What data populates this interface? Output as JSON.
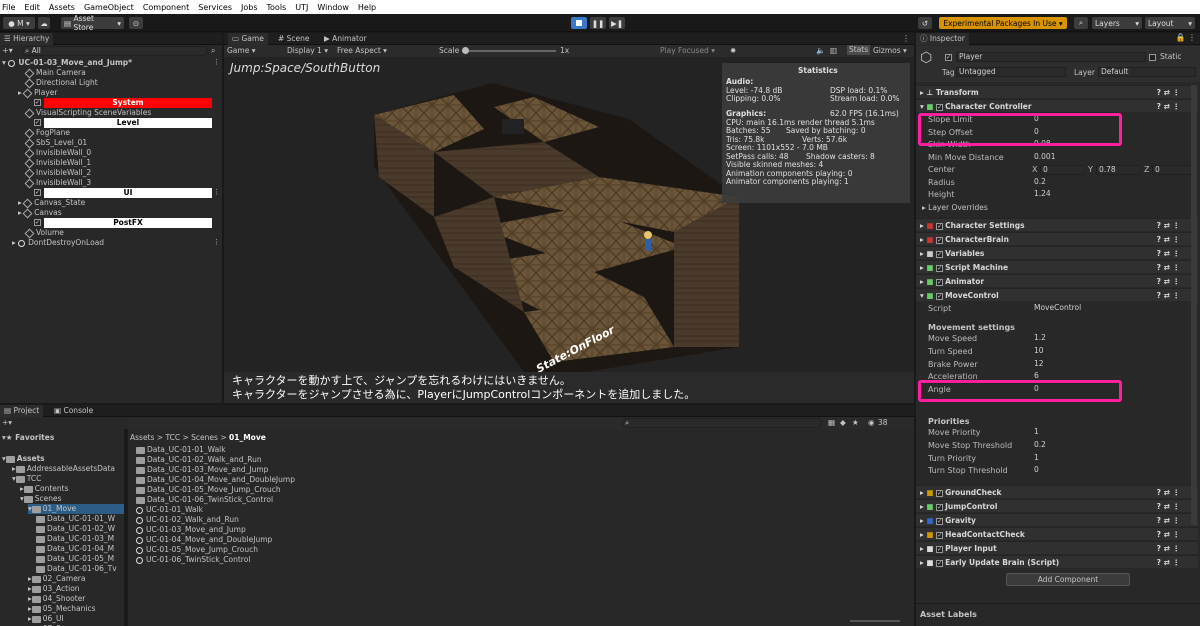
{
  "menu": [
    "File",
    "Edit",
    "Assets",
    "GameObject",
    "Component",
    "Services",
    "Jobs",
    "Tools",
    "UTJ",
    "Window",
    "Help"
  ],
  "toolbar": {
    "account": "M",
    "asset_store": "Asset Store",
    "experimental": "Experimental Packages In Use",
    "layers": "Layers",
    "layout": "Layout"
  },
  "hierarchy": {
    "tab": "Hierarchy",
    "search": "All",
    "scene": "UC-01-03_Move_and_Jump*",
    "items": [
      "Main Camera",
      "Directional Light",
      "Player",
      "System",
      "VisualScripting SceneVariables",
      "Level",
      "FogPlane",
      "SbS_Level_01",
      "InvisibleWall_0",
      "InvisibleWall_1",
      "InvisibleWall_2",
      "InvisibleWall_3",
      "UI",
      "Canvas_State",
      "Canvas",
      "PostFX",
      "Volume",
      "DontDestroyOnLoad"
    ]
  },
  "scene": {
    "tabs": [
      "Game",
      "Scene",
      "Animator"
    ],
    "display": "Game",
    "display_num": "Display 1",
    "aspect": "Free Aspect",
    "scale_label": "Scale",
    "scale_val": "1x",
    "play_focused": "Play Focused",
    "stats": "Stats",
    "gizmos": "Gizmos",
    "overlay_title": "Jump:Space/SouthButton",
    "state_label": "State:OnFloor",
    "subtitle1": "キャラクターを動かす上で、ジャンプを忘れるわけにはいきません。",
    "subtitle2": "キャラクターをジャンプさせる為に、PlayerにJumpControlコンポーネントを追加しました。"
  },
  "stats": {
    "title": "Statistics",
    "audio": "Audio:",
    "level": "Level: -74.8 dB",
    "clipping": "Clipping: 0.0%",
    "dsp": "DSP load: 0.1%",
    "stream": "Stream load: 0.0%",
    "graphics": "Graphics:",
    "fps": "62.0 FPS (16.1ms)",
    "cpu": "CPU: main 16.1ms  render thread 5.1ms",
    "batches": "Batches: 55",
    "saved": "Saved by batching: 0",
    "tris": "Tris: 75.8k",
    "verts": "Verts: 57.6k",
    "screen": "Screen: 1101x552 - 7.0 MB",
    "setpass": "SetPass calls: 48",
    "shadow": "Shadow casters: 8",
    "skinned": "Visible skinned meshes: 4",
    "anim": "Animation components playing: 0",
    "animator": "Animator components playing: 1"
  },
  "project": {
    "tabs": [
      "Project",
      "Console"
    ],
    "favorites": "Favorites",
    "assets": "Assets",
    "breadcrumb": [
      "Assets",
      "TCC",
      "Scenes",
      "01_Move"
    ],
    "count": "38",
    "tree": [
      "AddressableAssetsData",
      "TCC",
      "Contents",
      "Scenes",
      "01_Move",
      "Data_UC-01-01_W",
      "Data_UC-01-02_W",
      "Data_UC-01-03_M",
      "Data_UC-01-04_M",
      "Data_UC-01-05_M",
      "Data_UC-01-06_Tv",
      "02_Camera",
      "03_Action",
      "04_Shooter",
      "05_Mechanics",
      "06_UI",
      "07_Scene"
    ],
    "files": [
      "Data_UC-01-01_Walk",
      "Data_UC-01-02_Walk_and_Run",
      "Data_UC-01-03_Move_and_Jump",
      "Data_UC-01-04_Move_and_DoubleJump",
      "Data_UC-01-05_Move_Jump_Crouch",
      "Data_UC-01-06_TwinStick_Control",
      "UC-01-01_Walk",
      "UC-01-02_Walk_and_Run",
      "UC-01-03_Move_and_Jump",
      "UC-01-04_Move_and_DoubleJump",
      "UC-01-05_Move_Jump_Crouch",
      "UC-01-06_TwinStick_Control"
    ]
  },
  "inspector": {
    "tab": "Inspector",
    "name": "Player",
    "static": "Static",
    "tag_label": "Tag",
    "tag": "Untagged",
    "layer_label": "Layer",
    "layer": "Default",
    "transform": "Transform",
    "cc": "Character Controller",
    "cc_props": [
      [
        "Slope Limit",
        "0"
      ],
      [
        "Step Offset",
        "0"
      ],
      [
        "Skin Width",
        "0.08"
      ],
      [
        "Min Move Distance",
        "0.001"
      ]
    ],
    "center_label": "Center",
    "center": [
      "0",
      "0.78",
      "0"
    ],
    "radius_label": "Radius",
    "radius": "0.2",
    "height_label": "Height",
    "height": "1.24",
    "layer_overrides": "Layer Overrides",
    "components": [
      "Character Settings",
      "CharacterBrain",
      "Variables",
      "Script Machine",
      "Animator"
    ],
    "movecontrol": "MoveControl",
    "script_label": "Script",
    "script_val": "MoveControl",
    "movement_settings": "Movement settings",
    "mc_props": [
      [
        "Move Speed",
        "1.2"
      ],
      [
        "Turn Speed",
        "10"
      ],
      [
        "Brake Power",
        "12"
      ],
      [
        "Acceleration",
        "6"
      ],
      [
        "Angle",
        "0"
      ]
    ],
    "priorities": "Priorities",
    "pr_props": [
      [
        "Move Priority",
        "1"
      ],
      [
        "Move Stop Threshold",
        "0.2"
      ],
      [
        "Turn Priority",
        "1"
      ],
      [
        "Turn Stop Threshold",
        "0"
      ]
    ],
    "components2": [
      "GroundCheck",
      "JumpControl",
      "Gravity",
      "HeadContactCheck",
      "Player Input",
      "Early Update Brain (Script)"
    ],
    "add_component": "Add Component",
    "asset_labels": "Asset Labels"
  }
}
